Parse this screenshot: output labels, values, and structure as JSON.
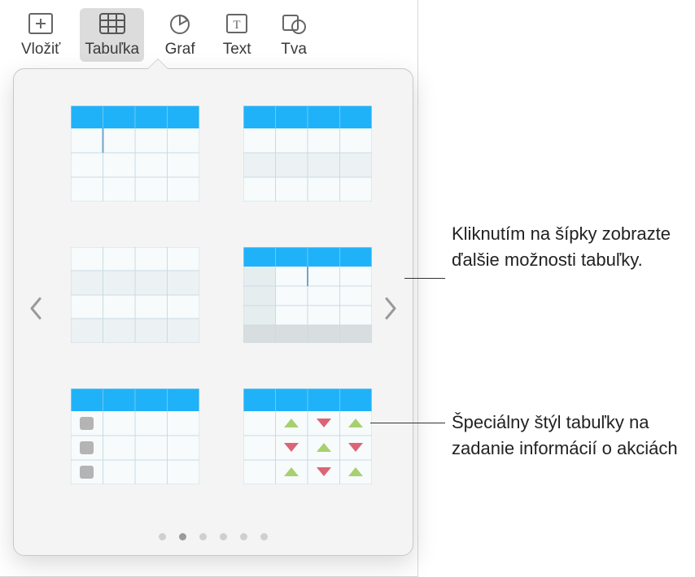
{
  "toolbar": {
    "items": [
      {
        "label": "Vložiť",
        "icon": "insert"
      },
      {
        "label": "Tabuľka",
        "icon": "table",
        "selected": true
      },
      {
        "label": "Graf",
        "icon": "chart"
      },
      {
        "label": "Text",
        "icon": "text"
      },
      {
        "label": "Tva",
        "icon": "shape"
      }
    ]
  },
  "popover": {
    "styles": [
      {
        "name": "header-blue",
        "type": "basic-header"
      },
      {
        "name": "header-blue-column",
        "type": "header-col"
      },
      {
        "name": "plain",
        "type": "plain"
      },
      {
        "name": "header-footer",
        "type": "header-footer"
      },
      {
        "name": "checkboxes",
        "type": "checkbox"
      },
      {
        "name": "stocks",
        "type": "stocks"
      }
    ],
    "page_count": 6,
    "active_page": 1
  },
  "callouts": {
    "arrow_tip": "Kliknutím na šípky zobrazte ďalšie možnosti tabuľky.",
    "stocks_tip": "Špeciálny štýl tabuľky na zadanie informácií o akciách"
  },
  "colors": {
    "header_blue": "#1FB2F9",
    "cell_bg": "#F7FBFC",
    "cell_alt": "#ECF2F3",
    "border": "#CADBE5",
    "up": "#A7D06F",
    "down": "#DC6476"
  }
}
